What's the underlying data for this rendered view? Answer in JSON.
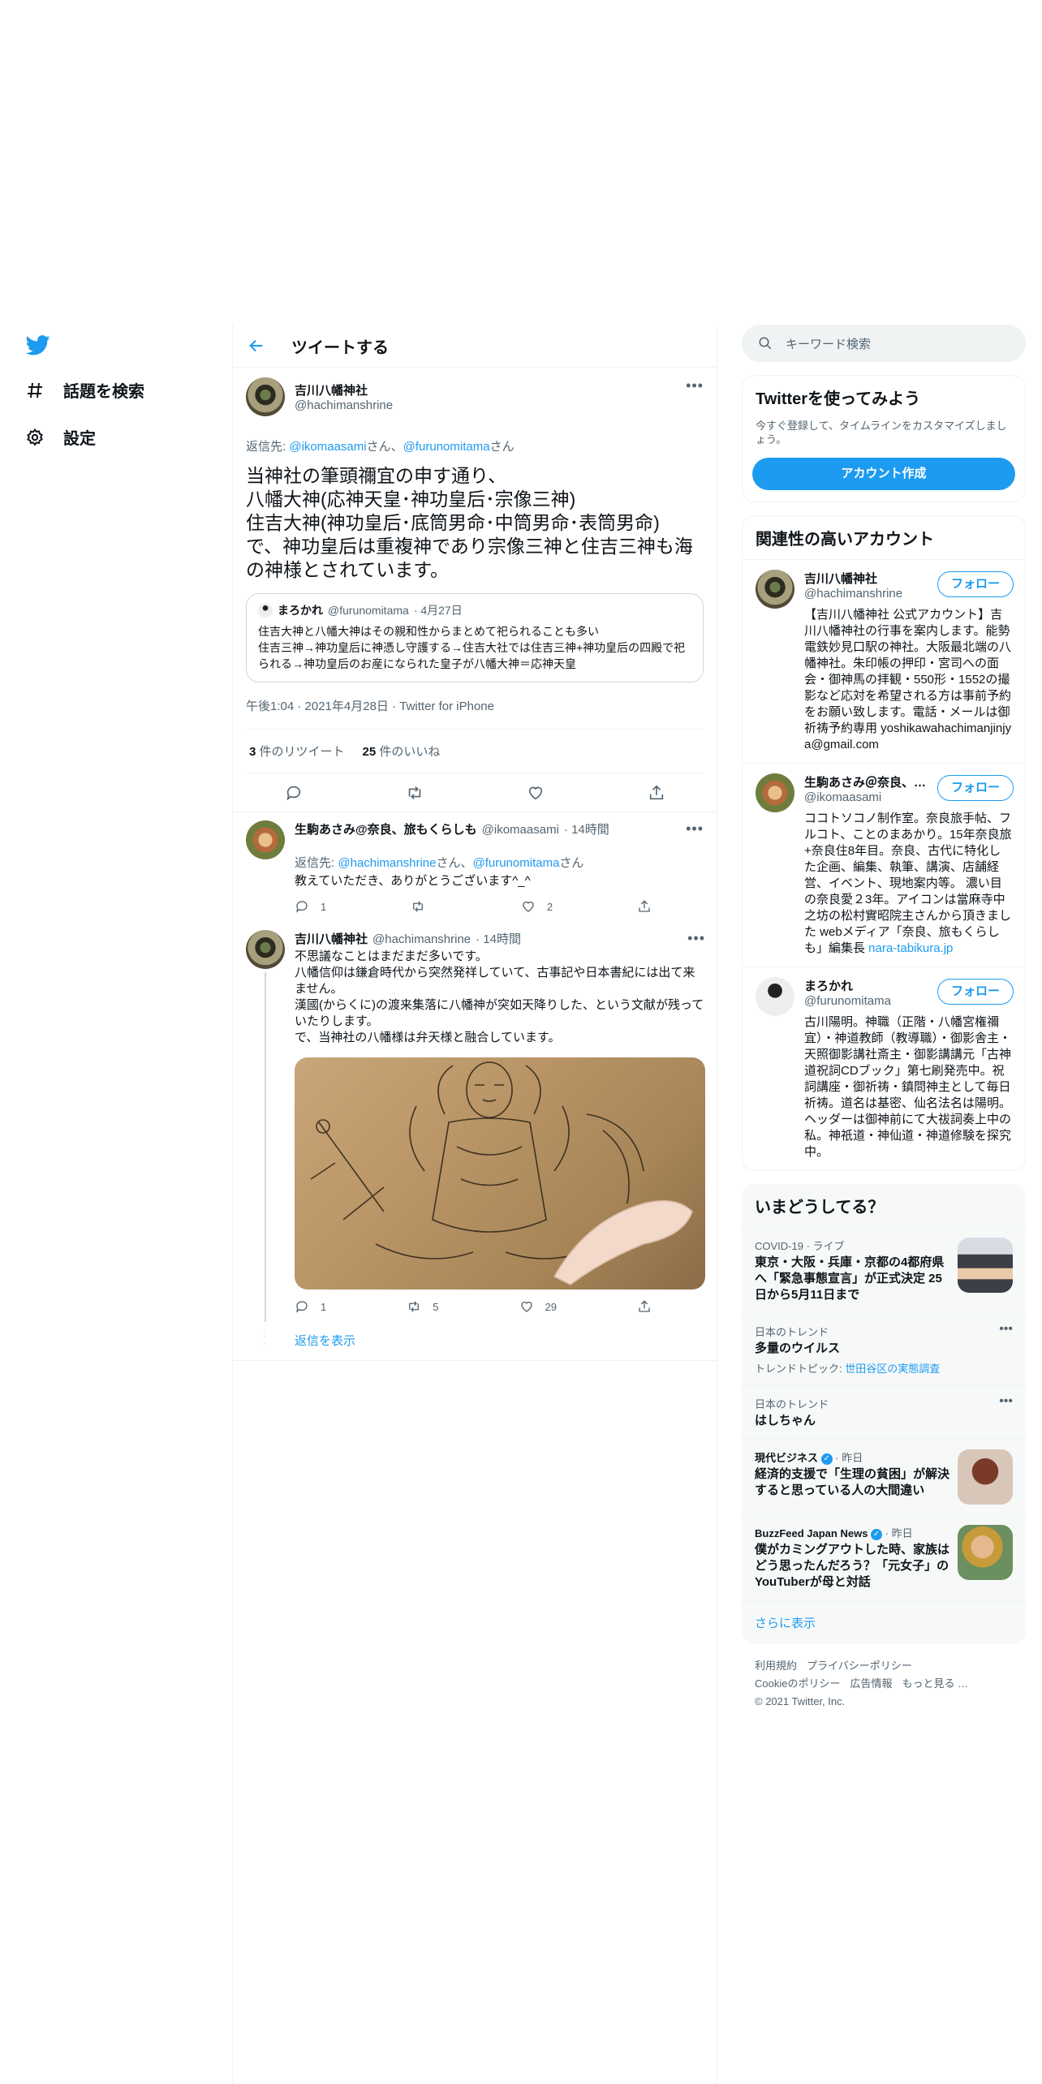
{
  "nav": {
    "items": [
      {
        "label": "話題を検索",
        "icon": "hashtag-icon"
      },
      {
        "label": "設定",
        "icon": "gear-icon"
      }
    ]
  },
  "header": {
    "title": "ツイートする"
  },
  "main_tweet": {
    "name": "吉川八幡神社",
    "handle": "@hachimanshrine",
    "reply_prefix": "返信先: ",
    "reply_user1": "@ikomaasami",
    "reply_san1": "さん、",
    "reply_user2": "@furunomitama",
    "reply_san2": "さん",
    "text": "当神社の筆頭禰宜の申す通り、\n八幡大神(応神天皇･神功皇后･宗像三神)\n住吉大神(神功皇后･底筒男命･中筒男命･表筒男命)\nで、神功皇后は重複神であり宗像三神と住吉三神も海の神様とされています。",
    "quote": {
      "name": "まろかれ",
      "handle": "@furunomitama",
      "date": "· 4月27日",
      "text": "住吉大神と八幡大神はその親和性からまとめて祀られることも多い\n住吉三神→神功皇后に神憑し守護する→住吉大社では住吉三神+神功皇后の四殿で祀られる→神功皇后のお産になられた皇子が八幡大神＝応神天皇"
    },
    "timestamp": "午後1:04 · 2021年4月28日 · Twitter for iPhone",
    "retweets_count": "3",
    "retweets_label": " 件のリツイート",
    "likes_count": "25",
    "likes_label": " 件のいいね"
  },
  "replies": [
    {
      "name": "生駒あさみ@奈良、旅もくらしも",
      "handle": "@ikomaasami",
      "time": "· 14時間",
      "reply_prefix": "返信先: ",
      "reply_user1": "@hachimanshrine",
      "reply_san1": "さん、",
      "reply_user2": "@furunomitama",
      "reply_san2": "さん",
      "text": "教えていただき、ありがとうございます^_^",
      "reply_count": "1",
      "retweet_count": "",
      "like_count": "2"
    },
    {
      "name": "吉川八幡神社",
      "handle": "@hachimanshrine",
      "time": "· 14時間",
      "text": "不思議なことはまだまだ多いです。\n八幡信仰は鎌倉時代から突然発祥していて、古事記や日本書紀には出て来ません。\n漢國(からくに)の渡来集落に八幡神が突如天降りした、という文献が残っていたりします。\nで、当神社の八幡様は弁天様と融合しています。",
      "reply_count": "1",
      "retweet_count": "5",
      "like_count": "29"
    }
  ],
  "show_replies": "返信を表示",
  "search": {
    "placeholder": "キーワード検索"
  },
  "try_twitter": {
    "title": "Twitterを使ってみよう",
    "desc": "今すぐ登録して、タイムラインをカスタマイズしましょう。",
    "button": "アカウント作成"
  },
  "related": {
    "title": "関連性の高いアカウント",
    "follow_label": "フォロー",
    "accounts": [
      {
        "name": "吉川八幡神社",
        "handle": "@hachimanshrine",
        "bio": "【吉川八幡神社 公式アカウント】吉川八幡神社の行事を案内します。能勢電鉄妙見口駅の神社。大阪最北端の八幡神社。朱印帳の押印・宮司への面会・御神馬の拝観・550形・1552の撮影など応対を希望される方は事前予約をお願い致します。電話・メールは御祈祷予約専用 yoshikawahachimanjinjya@gmail.com"
      },
      {
        "name": "生駒あさみ＠奈良、…",
        "handle": "@ikomaasami",
        "bio": "ココトソコノ制作室。奈良旅手帖、フルコト、ことのまあかり。15年奈良旅+奈良住8年目。奈良、古代に特化した企画、編集、執筆、講演、店舗経営、イベント、現地案内等。 濃い目の奈良愛２3年。アイコンは當麻寺中之坊の松村實昭院主さんから頂きました webメディア「奈良、旅もくらしも」編集長 ",
        "link": "nara-tabikura.jp"
      },
      {
        "name": "まろかれ",
        "handle": "@furunomitama",
        "bio": "古川陽明。神職（正階・八幡宮権禰宜）・神道教師（教導職）・御影舎主・天照御影講社斎主・御影講講元「古神道祝詞CDブック」第七刷発売中。祝詞講座・御祈祷・鎮問神主として毎日祈祷。道名は基密、仙名法名は陽明。ヘッダーは御神前にて大祓詞奏上中の私。神祇道・神仙道・神道修験を探究中。"
      }
    ]
  },
  "trends": {
    "title": "いまどうしてる？",
    "items": [
      {
        "category": "COVID-19 · ライブ",
        "title": "東京・大阪・兵庫・京都の4都府県へ「緊急事態宣言」が正式決定 25日から5月11日まで",
        "sub": "",
        "sub_link": ""
      },
      {
        "category": "日本のトレンド",
        "title": "多量のウイルス",
        "sub": "トレンドトピック: ",
        "sub_link": "世田谷区の実態調査"
      },
      {
        "category": "日本のトレンド",
        "title": "はしちゃん",
        "sub": "",
        "sub_link": ""
      },
      {
        "category": "現代ビジネス",
        "time": " · 昨日",
        "title": "経済的支援で「生理の貧困」が解決すると思っている人の大間違い",
        "sub": "",
        "sub_link": ""
      },
      {
        "category": "BuzzFeed Japan News",
        "time": " · 昨日",
        "title": "僕がカミングアウトした時、家族はどう思ったんだろう？「元女子」のYouTuberが母と対話",
        "sub": "",
        "sub_link": ""
      }
    ],
    "show_more": "さらに表示"
  },
  "footer": {
    "links": [
      "利用規約",
      "プライバシーポリシー",
      "Cookieのポリシー",
      "広告情報",
      "もっと見る …"
    ],
    "copyright": "© 2021 Twitter, Inc."
  },
  "colors": {
    "accent": "#1d9bf0",
    "text": "#0f1419",
    "muted": "#536471"
  }
}
